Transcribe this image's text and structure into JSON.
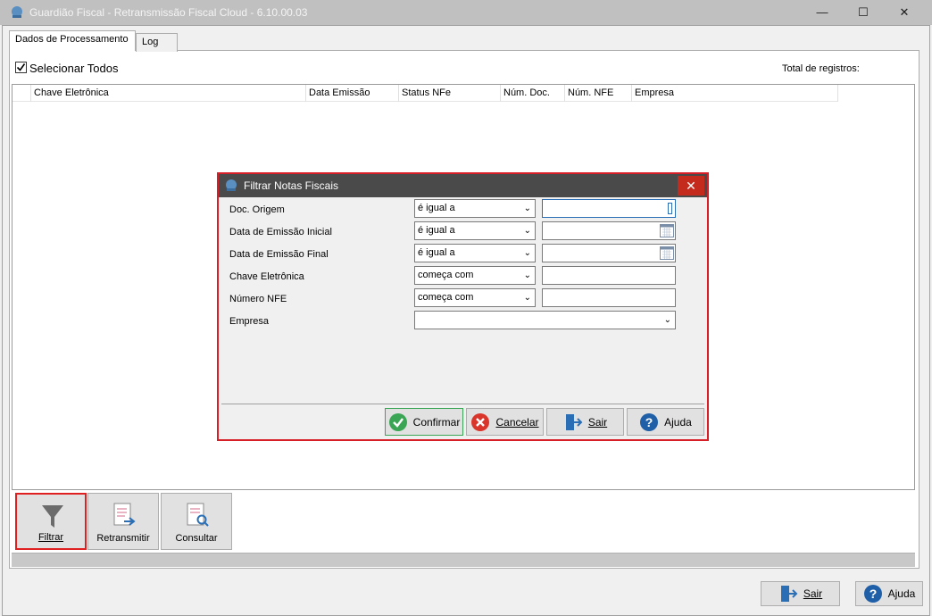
{
  "window": {
    "title": "Guardião Fiscal - Retransmissão Fiscal Cloud - 6.10.00.03",
    "minimize": "—",
    "maximize": "☐",
    "close": "✕"
  },
  "tabs": [
    {
      "label": "Dados de Processamento",
      "active": true
    },
    {
      "label": "Log",
      "active": false
    }
  ],
  "select_all": {
    "label": "Selecionar Todos",
    "checked": true
  },
  "total_label": "Total de registros:",
  "grid": {
    "columns": [
      "Chave Eletrônica",
      "Data Emissão",
      "Status NFe",
      "Núm. Doc.",
      "Núm. NFE",
      "Empresa"
    ]
  },
  "toolbar": {
    "filtrar": "Filtrar",
    "retransmitir": "Retransmitir",
    "consultar": "Consultar"
  },
  "footer": {
    "sair": "Sair",
    "ajuda": "Ajuda"
  },
  "dialog": {
    "title": "Filtrar Notas Fiscais",
    "close": "✕",
    "fields": [
      {
        "label": "Doc. Origem",
        "operator": "é igual a",
        "value": ""
      },
      {
        "label": "Data de Emissão Inicial",
        "operator": "é igual a",
        "value": ""
      },
      {
        "label": "Data de Emissão Final",
        "operator": "é igual a",
        "value": ""
      },
      {
        "label": "Chave Eletrônica",
        "operator": "começa com",
        "value": ""
      },
      {
        "label": "Número NFE",
        "operator": "começa com",
        "value": ""
      },
      {
        "label": "Empresa",
        "operator": "",
        "value": ""
      }
    ],
    "buttons": {
      "confirmar": "Confirmar",
      "cancelar": "Cancelar",
      "sair": "Sair",
      "ajuda": "Ajuda"
    }
  },
  "colors": {
    "accent_red": "#d61f26",
    "title_bar": "#c0c0c0",
    "dialog_title": "#4a4a4a",
    "confirm_green": "#3aa655",
    "cancel_red": "#d9352b",
    "help_blue": "#1f5fa8"
  }
}
